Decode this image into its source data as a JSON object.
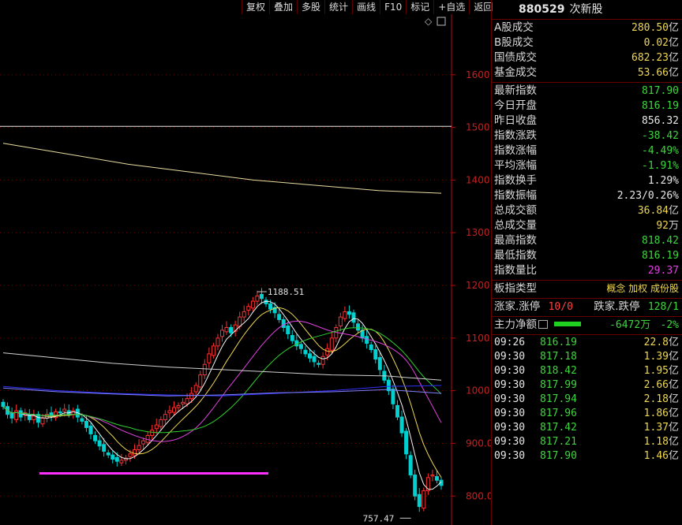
{
  "toolbar": {
    "items": [
      "复权",
      "叠加",
      "多股",
      "统计",
      "画线",
      "F10",
      "标记",
      "+自选",
      "返回"
    ]
  },
  "header": {
    "code": "880529",
    "name": "次新股"
  },
  "turnover": [
    {
      "label": "A股成交",
      "value": "280.50",
      "unit": "亿",
      "color": "y"
    },
    {
      "label": "B股成交",
      "value": "0.02",
      "unit": "亿",
      "color": "y"
    },
    {
      "label": "国债成交",
      "value": "682.23",
      "unit": "亿",
      "color": "y"
    },
    {
      "label": "基金成交",
      "value": "53.66",
      "unit": "亿",
      "color": "y"
    }
  ],
  "stats": [
    {
      "label": "最新指数",
      "value": "817.90",
      "color": "g"
    },
    {
      "label": "今日开盘",
      "value": "816.19",
      "color": "g"
    },
    {
      "label": "昨日收盘",
      "value": "856.32",
      "color": "w"
    },
    {
      "label": "指数涨跌",
      "value": "-38.42",
      "color": "g"
    },
    {
      "label": "指数涨幅",
      "value": "-4.49%",
      "color": "g"
    },
    {
      "label": "平均涨幅",
      "value": "-1.91%",
      "color": "g"
    },
    {
      "label": "指数换手",
      "value": "1.29%",
      "color": "w"
    },
    {
      "label": "指数振幅",
      "value": "2.23/0.26%",
      "color": "w"
    },
    {
      "label": "总成交额",
      "value": "36.84",
      "unit": "亿",
      "color": "y"
    },
    {
      "label": "总成交量",
      "value": "92",
      "unit": "万",
      "color": "y"
    },
    {
      "label": "最高指数",
      "value": "818.42",
      "color": "g"
    },
    {
      "label": "最低指数",
      "value": "816.19",
      "color": "g"
    },
    {
      "label": "指数量比",
      "value": "29.37",
      "color": "m"
    }
  ],
  "sector": {
    "label": "板指类型",
    "value": "概念 加权 成份股"
  },
  "breadth": {
    "label1": "涨家.涨停",
    "value1": "10/0",
    "label2": "跌家.跌停",
    "value2": "128/1"
  },
  "capital": {
    "label": "主力净额",
    "value": "-6472万",
    "pct": "-2%"
  },
  "ticks": [
    {
      "time": "09:26",
      "price": "816.19",
      "vol": "22.8",
      "unit": "亿"
    },
    {
      "time": "09:30",
      "price": "817.18",
      "vol": "1.39",
      "unit": "亿"
    },
    {
      "time": "09:30",
      "price": "818.42",
      "vol": "1.95",
      "unit": "亿"
    },
    {
      "time": "09:30",
      "price": "817.99",
      "vol": "2.66",
      "unit": "亿"
    },
    {
      "time": "09:30",
      "price": "817.94",
      "vol": "2.18",
      "unit": "亿"
    },
    {
      "time": "09:30",
      "price": "817.96",
      "vol": "1.86",
      "unit": "亿"
    },
    {
      "time": "09:30",
      "price": "817.42",
      "vol": "1.37",
      "unit": "亿"
    },
    {
      "time": "09:30",
      "price": "817.21",
      "vol": "1.18",
      "unit": "亿"
    },
    {
      "time": "09:30",
      "price": "817.90",
      "vol": "1.46",
      "unit": "亿"
    }
  ],
  "chart_data": {
    "type": "candlestick",
    "y_ticks": [
      "1600",
      "1500",
      "1400",
      "1300",
      "1200",
      "1100",
      "1000",
      "900.0",
      "800.0"
    ],
    "ylim": [
      745,
      1715
    ],
    "annotations": {
      "high": "1188.51",
      "low": "757.47"
    },
    "closes": [
      970,
      955,
      948,
      962,
      950,
      958,
      945,
      952,
      940,
      948,
      955,
      952,
      960,
      958,
      965,
      955,
      962,
      950,
      942,
      930,
      918,
      905,
      895,
      885,
      878,
      870,
      866,
      868,
      872,
      880,
      888,
      896,
      905,
      915,
      925,
      935,
      945,
      955,
      962,
      968,
      972,
      978,
      985,
      995,
      1010,
      1030,
      1050,
      1070,
      1085,
      1100,
      1115,
      1120,
      1110,
      1125,
      1140,
      1150,
      1160,
      1170,
      1180,
      1175,
      1165,
      1155,
      1148,
      1135,
      1120,
      1108,
      1095,
      1085,
      1080,
      1070,
      1062,
      1055,
      1050,
      1065,
      1080,
      1100,
      1120,
      1140,
      1150,
      1145,
      1130,
      1115,
      1100,
      1090,
      1078,
      1060,
      1040,
      1020,
      1000,
      975,
      950,
      920,
      880,
      840,
      800,
      780,
      810,
      835,
      840,
      830,
      820
    ],
    "colors": {
      "up": "#ff3030",
      "down": "#00d0d0"
    }
  },
  "colors": {
    "grid": "#7a0000",
    "axis": "#b01010",
    "tick_text": "#c82020",
    "ma": [
      "#f5f5f5",
      "#f0d850",
      "#e040e0",
      "#30d030",
      "#3030ff",
      "#d0d0d0"
    ]
  }
}
